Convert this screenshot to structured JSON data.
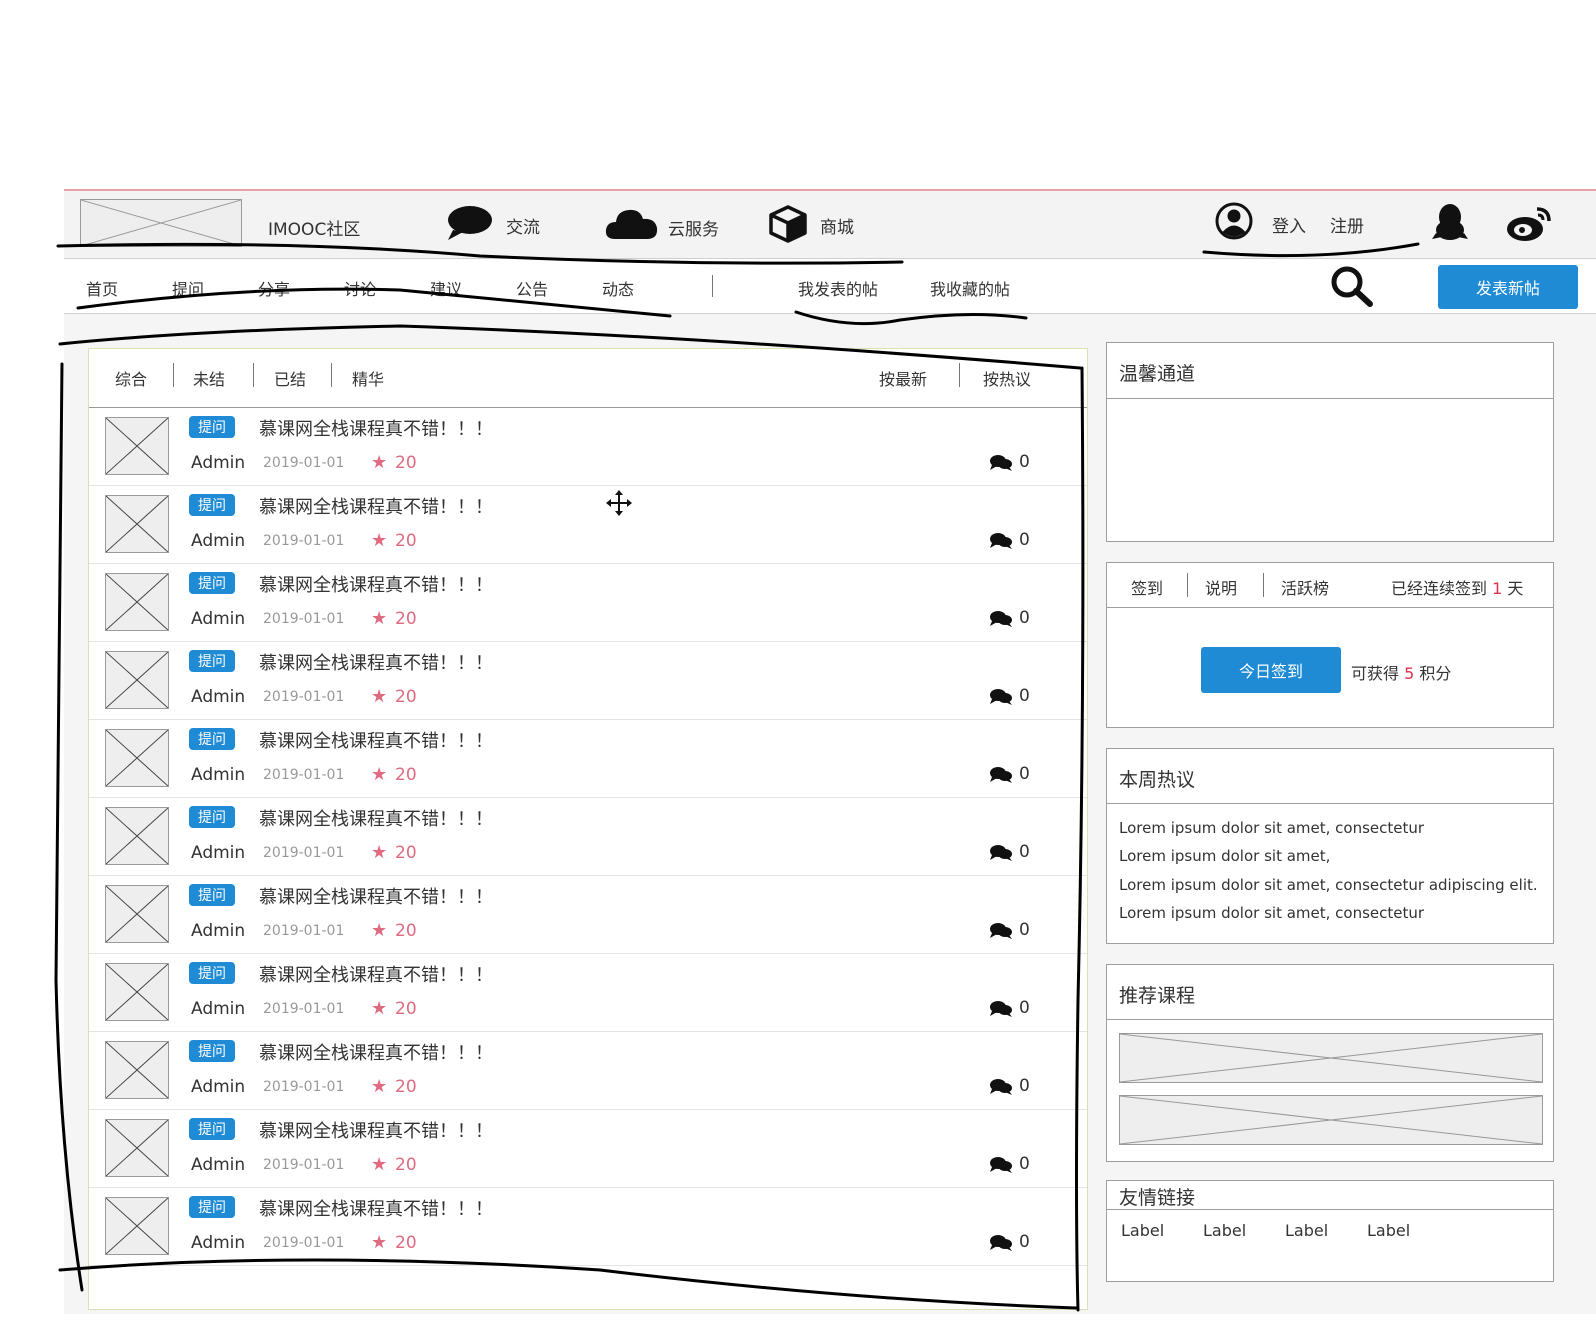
{
  "header": {
    "site_name": "IMOOC社区",
    "nav": [
      {
        "label": "交流",
        "icon": "chat-bubble-icon"
      },
      {
        "label": "云服务",
        "icon": "cloud-icon"
      },
      {
        "label": "商城",
        "icon": "box-icon"
      }
    ],
    "login_label": "登入",
    "register_label": "注册",
    "user_icon": "user-circle-icon",
    "qq_icon": "qq-icon",
    "weibo_icon": "weibo-icon"
  },
  "navbar": {
    "items": [
      "首页",
      "提问",
      "分享",
      "讨论",
      "建议",
      "公告",
      "动态"
    ],
    "my_posts": "我发表的帖",
    "my_favorites": "我收藏的帖",
    "search_icon": "search-icon",
    "publish_label": "发表新帖"
  },
  "filters": {
    "tabs": [
      "综合",
      "未结",
      "已结",
      "精华"
    ],
    "sort_newest": "按最新",
    "sort_hot": "按热议"
  },
  "posts": [
    {
      "tag": "提问",
      "title": "慕课网全栈课程真不错！！！",
      "author": "Admin",
      "date": "2019-01-01",
      "score": "20",
      "comments": "0"
    },
    {
      "tag": "提问",
      "title": "慕课网全栈课程真不错！！！",
      "author": "Admin",
      "date": "2019-01-01",
      "score": "20",
      "comments": "0"
    },
    {
      "tag": "提问",
      "title": "慕课网全栈课程真不错！！！",
      "author": "Admin",
      "date": "2019-01-01",
      "score": "20",
      "comments": "0"
    },
    {
      "tag": "提问",
      "title": "慕课网全栈课程真不错！！！",
      "author": "Admin",
      "date": "2019-01-01",
      "score": "20",
      "comments": "0"
    },
    {
      "tag": "提问",
      "title": "慕课网全栈课程真不错！！！",
      "author": "Admin",
      "date": "2019-01-01",
      "score": "20",
      "comments": "0"
    },
    {
      "tag": "提问",
      "title": "慕课网全栈课程真不错！！！",
      "author": "Admin",
      "date": "2019-01-01",
      "score": "20",
      "comments": "0"
    },
    {
      "tag": "提问",
      "title": "慕课网全栈课程真不错！！！",
      "author": "Admin",
      "date": "2019-01-01",
      "score": "20",
      "comments": "0"
    },
    {
      "tag": "提问",
      "title": "慕课网全栈课程真不错！！！",
      "author": "Admin",
      "date": "2019-01-01",
      "score": "20",
      "comments": "0"
    },
    {
      "tag": "提问",
      "title": "慕课网全栈课程真不错！！！",
      "author": "Admin",
      "date": "2019-01-01",
      "score": "20",
      "comments": "0"
    },
    {
      "tag": "提问",
      "title": "慕课网全栈课程真不错！！！",
      "author": "Admin",
      "date": "2019-01-01",
      "score": "20",
      "comments": "0"
    },
    {
      "tag": "提问",
      "title": "慕课网全栈课程真不错！！！",
      "author": "Admin",
      "date": "2019-01-01",
      "score": "20",
      "comments": "0"
    }
  ],
  "sidebar": {
    "warm_channel": {
      "title": "温馨通道"
    },
    "checkin": {
      "tabs": [
        "签到",
        "说明",
        "活跃榜"
      ],
      "streak_prefix": "已经连续签到",
      "streak_days": "1",
      "streak_suffix": "天",
      "button_label": "今日签到",
      "reward_prefix": "可获得",
      "reward_points": "5",
      "reward_suffix": "积分"
    },
    "hot_week": {
      "title": "本周热议",
      "lines": [
        "Lorem ipsum dolor sit amet, consectetur",
        "Lorem ipsum dolor sit amet,",
        "Lorem ipsum dolor sit amet, consectetur adipiscing elit.",
        "Lorem ipsum dolor sit amet, consectetur"
      ]
    },
    "recommended": {
      "title": "推荐课程"
    },
    "friend_links": {
      "title": "友情链接",
      "labels": [
        "Label",
        "Label",
        "Label",
        "Label"
      ]
    }
  },
  "colors": {
    "accent": "#1e8bd4",
    "score_red": "#e06a80",
    "header_bg": "#f3f3f3",
    "annotation_ink": "#000000"
  }
}
